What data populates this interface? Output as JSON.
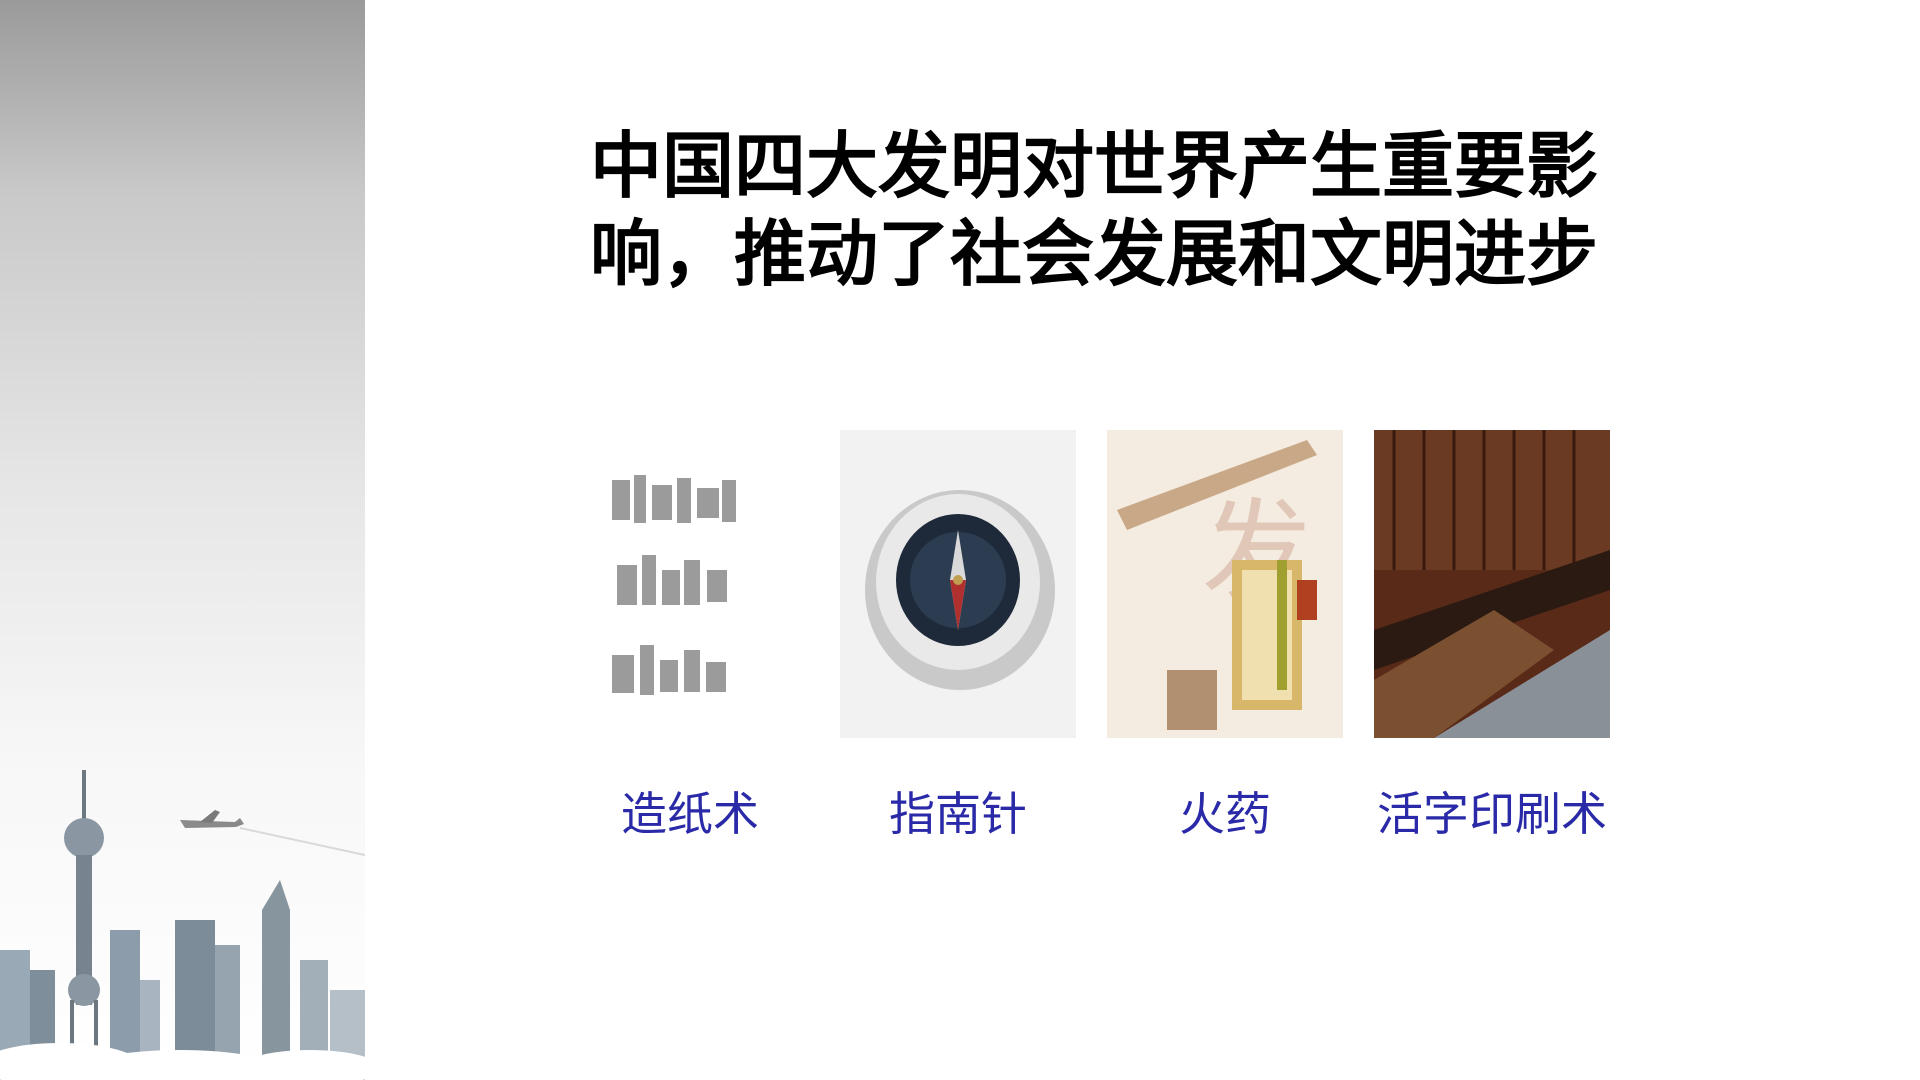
{
  "title": {
    "line1": "中国四大发明对世界产生重要影",
    "line2": "响，推动了社会发展和文明进步"
  },
  "inventions": [
    {
      "label": "造纸术",
      "icon": "papermaking-illustration"
    },
    {
      "label": "指南针",
      "icon": "compass-photo"
    },
    {
      "label": "火药",
      "icon": "gunpowder-book-cover"
    },
    {
      "label": "活字印刷术",
      "icon": "movable-type-printing-photo"
    }
  ],
  "colors": {
    "label": "#2a2aa8",
    "title": "#000000"
  }
}
